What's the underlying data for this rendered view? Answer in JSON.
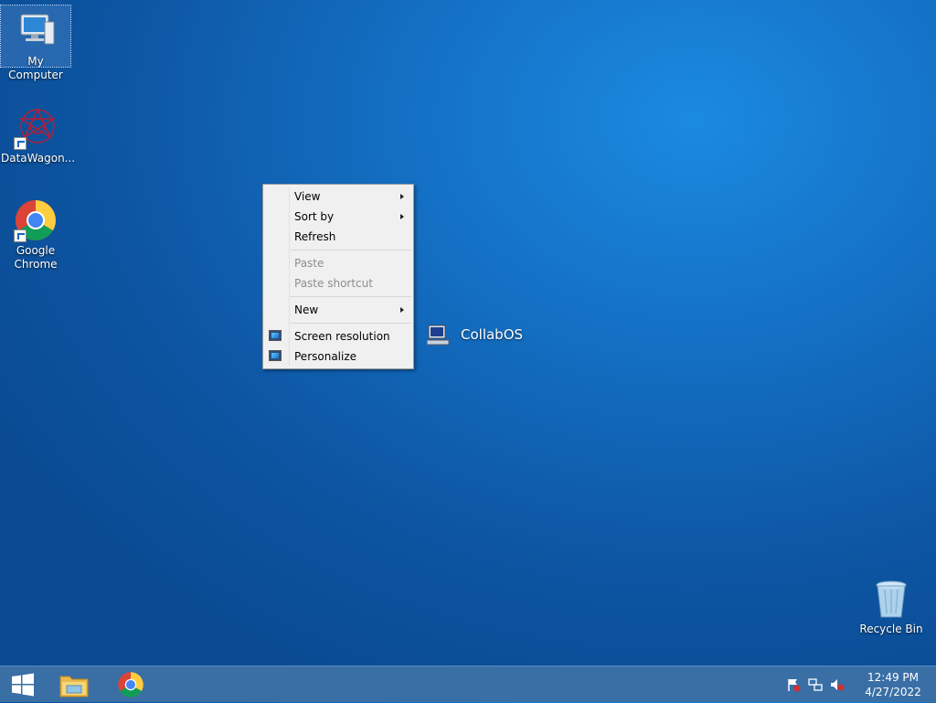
{
  "desktop": {
    "icons": {
      "my_computer": "My Computer",
      "datawagon": "DataWagon...",
      "google_chrome": "Google Chrome",
      "recycle_bin": "Recycle Bin"
    },
    "collabos_label": "CollabOS"
  },
  "context_menu": {
    "view": "View",
    "sort_by": "Sort by",
    "refresh": "Refresh",
    "paste": "Paste",
    "paste_shortcut": "Paste shortcut",
    "new": "New",
    "screen_resolution": "Screen resolution",
    "personalize": "Personalize"
  },
  "taskbar": {
    "time": "12:49 PM",
    "date": "4/27/2022"
  },
  "colors": {
    "accent": "#1470c4",
    "taskbar": "#3a6fa6"
  }
}
